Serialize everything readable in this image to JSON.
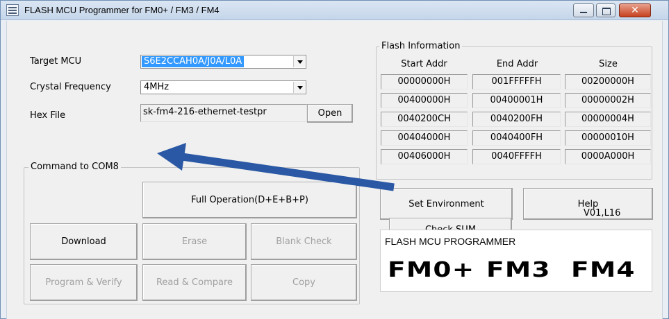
{
  "window": {
    "title": "FLASH MCU Programmer for FM0+ / FM3 / FM4",
    "controls": [
      "minimize",
      "maximize",
      "close"
    ],
    "close_glyph": "✕"
  },
  "target_mcu": {
    "label": "Target MCU",
    "value": "S6E2CCAH0A/J0A/L0A"
  },
  "crystal": {
    "label": "Crystal Frequency",
    "value": "4MHz"
  },
  "hex_file": {
    "label": "Hex File",
    "value": "sk-fm4-216-ethernet-testpr",
    "open_label": "Open"
  },
  "command_group": {
    "legend": "Command to COM8",
    "full_operation": "Full Operation(D+E+B+P)",
    "download": "Download",
    "erase": "Erase",
    "blank_check": "Blank Check",
    "program_verify": "Program & Verify",
    "read_compare": "Read & Compare",
    "copy": "Copy"
  },
  "flash_info": {
    "legend": "Flash Information",
    "headers": [
      "Start Addr",
      "End Addr",
      "Size"
    ],
    "rows": [
      [
        "00000000H",
        "001FFFFFH",
        "00200000H"
      ],
      [
        "00400000H",
        "00400001H",
        "00000002H"
      ],
      [
        "0040200CH",
        "0040200FH",
        "00000004H"
      ],
      [
        "00404000H",
        "0040400FH",
        "00000010H"
      ],
      [
        "00406000H",
        "0040FFFFH",
        "0000A000H"
      ]
    ]
  },
  "set_environment": "Set Environment",
  "help": "Help",
  "check_sum": "Check SUM",
  "version": "V01,L16",
  "logo": {
    "caption": "FLASH MCU PROGRAMMER",
    "words": [
      "FM0+",
      "FM3",
      "FM4"
    ]
  },
  "colors": {
    "arrow": "#2a58a4",
    "selection": "#3399ff"
  }
}
